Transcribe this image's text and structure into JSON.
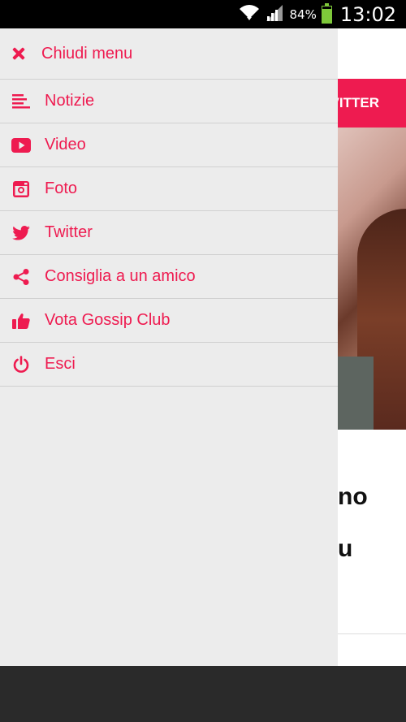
{
  "status_bar": {
    "battery_percent": "84%",
    "battery_level": 0.84,
    "time": "13:02"
  },
  "colors": {
    "accent": "#ee1b50",
    "drawer_bg": "#ececec",
    "battery": "#7ec83a"
  },
  "drawer": {
    "close_label": "Chiudi menu",
    "close_icon": "close-icon",
    "items": [
      {
        "label": "Notizie",
        "icon": "news-lines-icon"
      },
      {
        "label": "Video",
        "icon": "youtube-play-icon"
      },
      {
        "label": "Foto",
        "icon": "instagram-icon"
      },
      {
        "label": "Twitter",
        "icon": "twitter-bird-icon"
      },
      {
        "label": "Consiglia a un amico",
        "icon": "share-icon"
      },
      {
        "label": "Vota Gossip Club",
        "icon": "thumbs-up-icon"
      },
      {
        "label": "Esci",
        "icon": "power-icon"
      }
    ]
  },
  "background": {
    "tab_label_partial": "VITTER",
    "headline_partial_line1": "no",
    "headline_partial_line2": "u"
  }
}
